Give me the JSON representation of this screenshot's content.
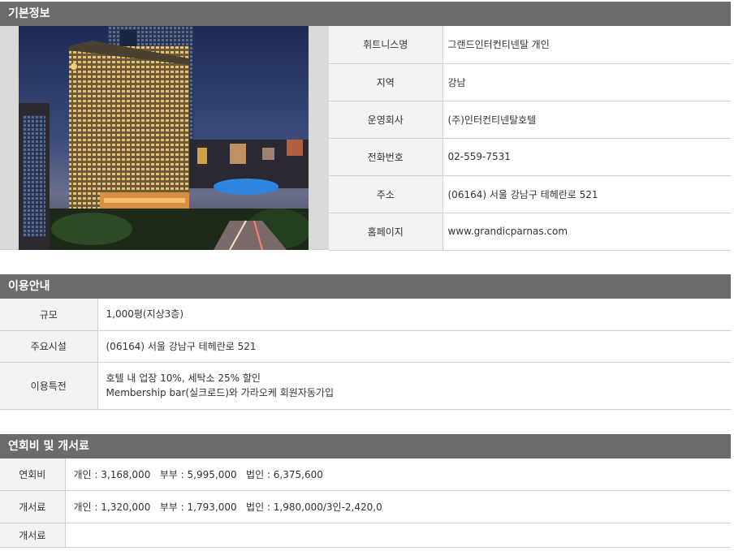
{
  "basic": {
    "header": "기본정보",
    "rows": [
      {
        "label": "휘트니스명",
        "value": "그랜드인터컨티넨탈 개인"
      },
      {
        "label": "지역",
        "value": "강남"
      },
      {
        "label": "운영회사",
        "value": "(주)인터컨티넨탈호텔"
      },
      {
        "label": "전화번호",
        "value": "02-559-7531"
      },
      {
        "label": "주소",
        "value": "(06164) 서울 강남구 테헤란로 521"
      },
      {
        "label": "홈페이지",
        "value": "www.grandicparnas.com"
      }
    ]
  },
  "guide": {
    "header": "이용안내",
    "rows": [
      {
        "label": "규모",
        "value": "1,000평(지상3층)"
      },
      {
        "label": "주요시설",
        "value": "(06164) 서울 강남구 테헤란로 521"
      },
      {
        "label": "이용특전",
        "line1": "호텔 내 업장 10%, 세탁소 25% 할인",
        "line2": "Membership bar(실크로드)와 가라오케 회원자동가입"
      }
    ]
  },
  "fees": {
    "header": "연회비 및 개서료",
    "rows": [
      {
        "label": "연회비",
        "value": "개인 : 3,168,000   부부 : 5,995,000   법인 : 6,375,600"
      },
      {
        "label": "개서료",
        "value": "개인 : 1,320,000   부부 : 1,793,000   법인 : 1,980,000/3인-2,420,0"
      },
      {
        "label": "개서료",
        "value": ""
      }
    ]
  }
}
